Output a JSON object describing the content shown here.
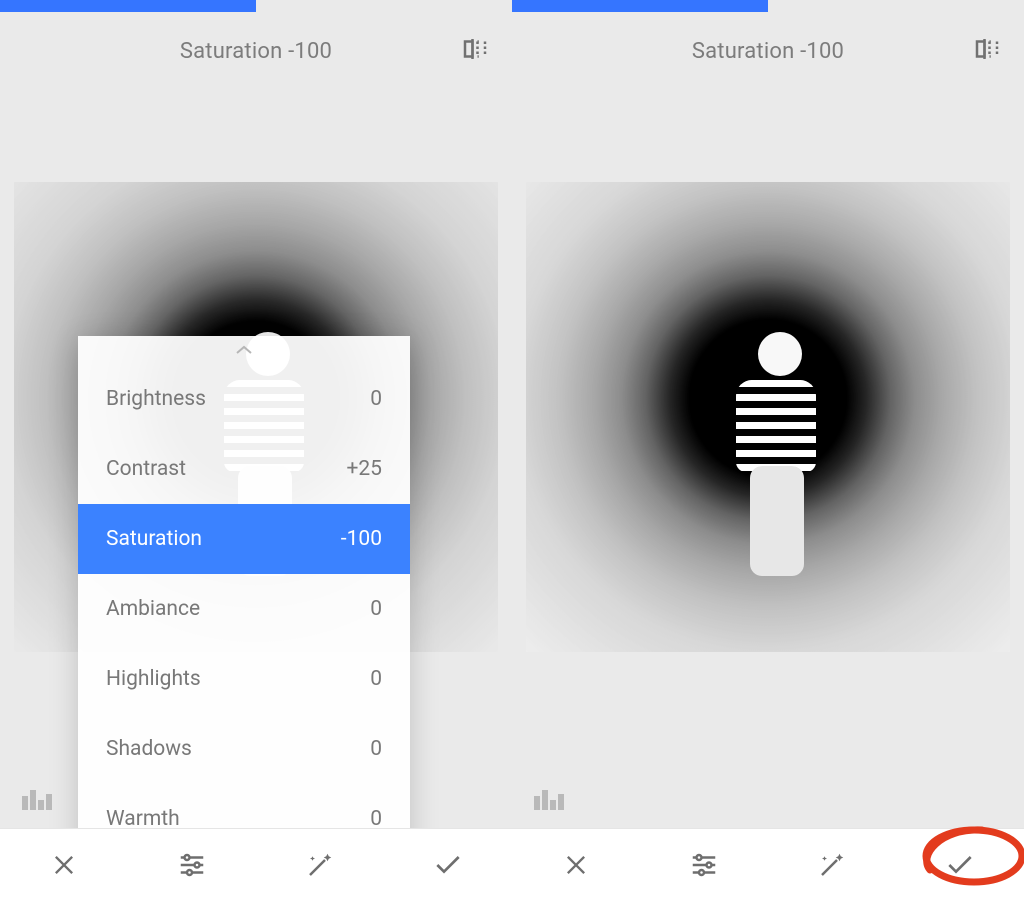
{
  "colors": {
    "accent": "#3b82ff",
    "text_muted": "#7c7c7c"
  },
  "left": {
    "header_label": "Saturation -100",
    "panel": {
      "items": [
        {
          "label": "Brightness",
          "value": "0",
          "selected": false
        },
        {
          "label": "Contrast",
          "value": "+25",
          "selected": false
        },
        {
          "label": "Saturation",
          "value": "-100",
          "selected": true
        },
        {
          "label": "Ambiance",
          "value": "0",
          "selected": false
        },
        {
          "label": "Highlights",
          "value": "0",
          "selected": false
        },
        {
          "label": "Shadows",
          "value": "0",
          "selected": false
        },
        {
          "label": "Warmth",
          "value": "0",
          "selected": false
        }
      ]
    },
    "toolbar": {
      "cancel_name": "cancel",
      "adjust_name": "adjustments",
      "magic_name": "auto-enhance",
      "apply_name": "apply"
    }
  },
  "right": {
    "header_label": "Saturation -100",
    "toolbar": {
      "cancel_name": "cancel",
      "adjust_name": "adjustments",
      "magic_name": "auto-enhance",
      "apply_name": "apply"
    },
    "annotation_target": "apply-button"
  }
}
